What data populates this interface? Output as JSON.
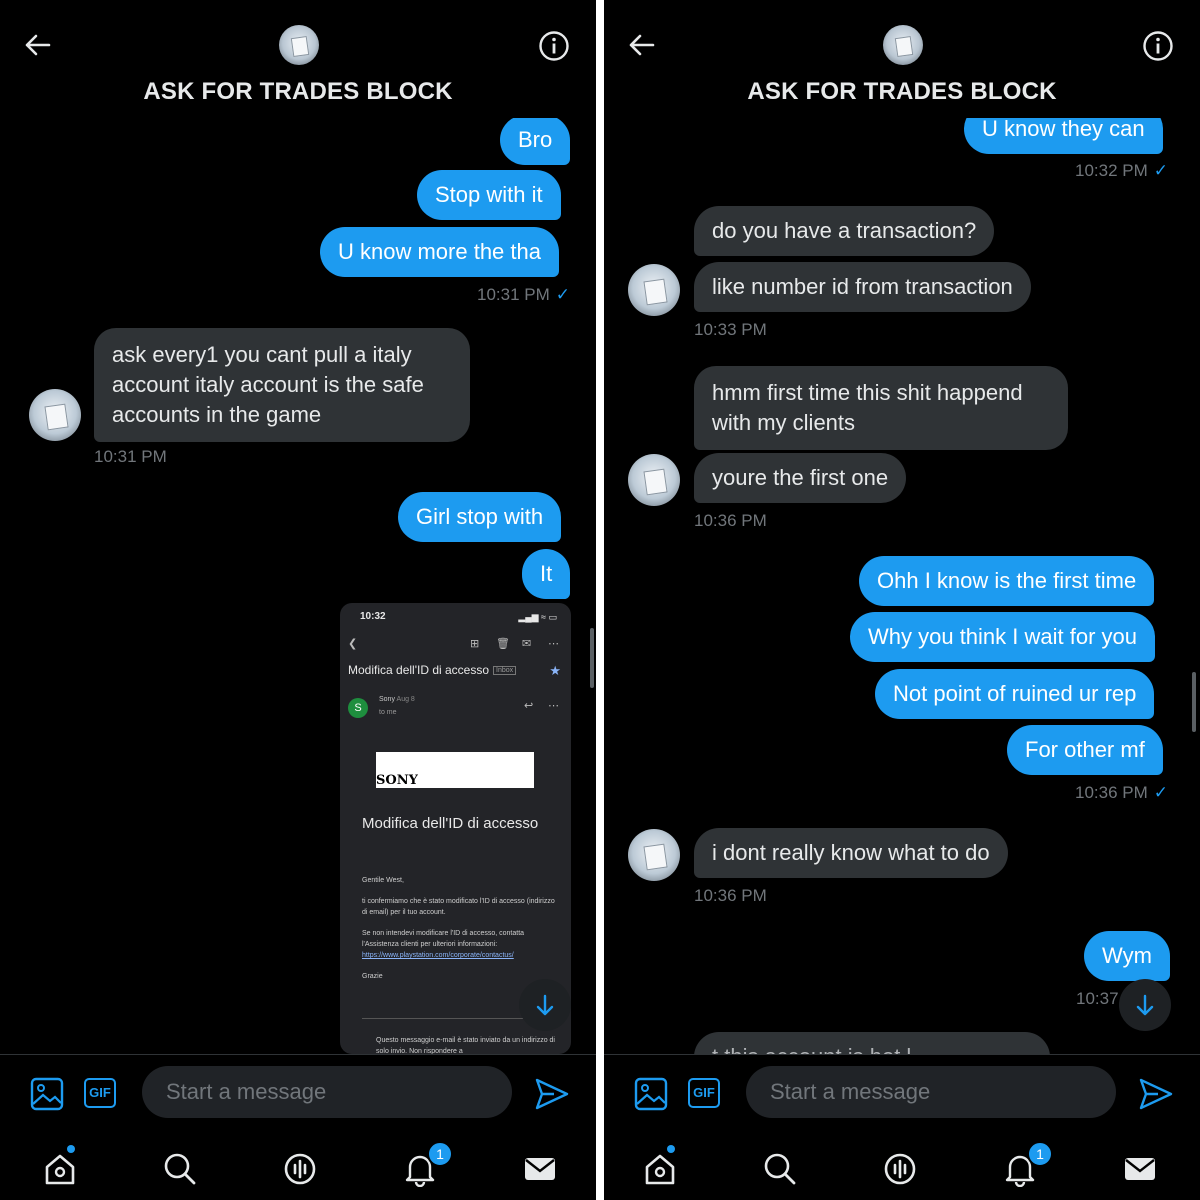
{
  "left": {
    "title": "ASK FOR TRADES BLOCK",
    "sent_bubbles": [
      "Bro",
      "Stop with it",
      "U know more the tha"
    ],
    "ts1": "10:31 PM",
    "ts1_check": "✓",
    "recv_bubble": "ask every1 you cant pull a italy account italy account is the safe accounts in the game",
    "ts2": "10:31 PM",
    "sent_bubbles_2": [
      "Girl stop with",
      "It"
    ],
    "email": {
      "time": "10:32",
      "status": "▂▄▆ ≈ ▭",
      "subject": "Modifica dell'ID di accesso",
      "inbox_tag": "Inbox",
      "sender": "Sony",
      "sender_date": "Aug 8",
      "sender_initial": "S",
      "to": "to me",
      "logo": "SONY",
      "heading": "Modifica dell'ID di accesso",
      "greeting": "Gentile West,",
      "para1": "ti confermiamo che è stato modificato l'ID di accesso (indirizzo di email) per il tuo account.",
      "para2": "Se non intendevi modificare l'ID di accesso, contatta l'Assistenza clienti per ulteriori informazioni:",
      "link": "https://www.playstation.com/corporate/contactus/",
      "thanks": "Grazie",
      "footer": "Questo messaggio e-mail è stato inviato da un indirizzo di solo invio. Non rispondere a"
    },
    "composer_placeholder": "Start a message",
    "gif_label": "GIF",
    "notif_count": "1"
  },
  "right": {
    "title": "ASK FOR TRADES BLOCK",
    "top_sent": "U know they can",
    "ts1": "10:32 PM",
    "recv_group1": [
      "do you have a transaction?",
      "like number id from transaction"
    ],
    "ts2": "10:33 PM",
    "recv_group2_multi": "hmm first time this shit happend with my clients",
    "recv_group2_single": "youre the first one",
    "ts3": "10:36 PM",
    "sent_group": [
      "Ohh I know is the first time",
      "Why you think I wait for you",
      "Not point of ruined ur rep",
      "For other mf"
    ],
    "ts4": "10:36 PM",
    "recv_single": "i dont really know what to do",
    "ts5": "10:36 PM",
    "sent_last": "Wym",
    "ts6": "10:37",
    "partial_text": "t this account is hot l...",
    "composer_placeholder": "Start a message",
    "gif_label": "GIF",
    "notif_count": "1"
  },
  "colors": {
    "accent": "#1d9bf0",
    "bubble_received": "#2f3336",
    "background": "#000000",
    "muted": "#71767b"
  }
}
